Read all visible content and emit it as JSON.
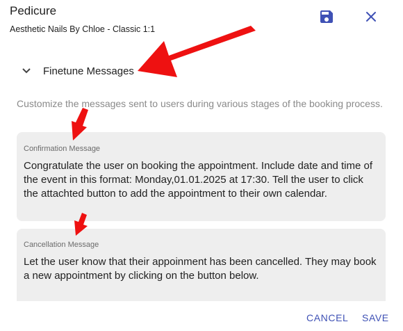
{
  "dialog": {
    "title": "Pedicure",
    "subtitle": "Aesthetic Nails By Chloe - Classic 1:1",
    "save_icon": "save-icon",
    "close_icon": "close-icon"
  },
  "section": {
    "title": "Finetune Messages",
    "expanded": true,
    "description": "Customize the messages sent to users during various stages of the booking process."
  },
  "fields": {
    "confirmation": {
      "label": "Confirmation Message",
      "value": "Congratulate the user on booking the appointment. Include date and time of the event in this format: Monday,01.01.2025 at 17:30. Tell the user to click the attachted button to add the appointment to their own calendar."
    },
    "cancellation": {
      "label": "Cancellation Message",
      "value": "Let the user know that their appoinment has been cancelled. They may book a new appointment by clicking on the button below."
    }
  },
  "footer": {
    "cancel_label": "CANCEL",
    "save_label": "SAVE"
  },
  "colors": {
    "accent": "#3f51b5",
    "annotation_arrow": "#ee1111"
  }
}
